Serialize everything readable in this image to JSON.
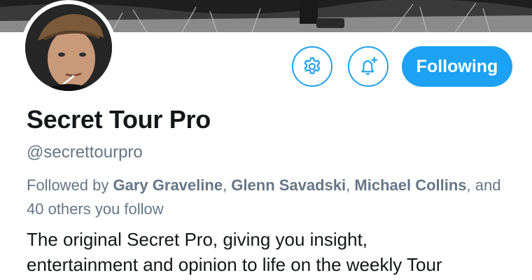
{
  "profile": {
    "display_name": "Secret Tour Pro",
    "handle": "@secrettourpro"
  },
  "actions": {
    "settings_icon": "gear-icon",
    "notify_icon": "bell-plus-icon",
    "follow_label": "Following"
  },
  "followed_by": {
    "prefix": "Followed by",
    "names": [
      "Gary Graveline",
      "Glenn Savadski",
      "Michael Collins"
    ],
    "separator_1": ", ",
    "separator_2": ", ",
    "suffix": ", and 40 others you follow"
  },
  "bio": {
    "line1": "The original Secret Pro, giving you insight,",
    "line2": "entertainment and opinion to life on the weekly Tour"
  },
  "colors": {
    "accent": "#1da1f2",
    "secondary_text": "#657786",
    "primary_text": "#14171a"
  }
}
